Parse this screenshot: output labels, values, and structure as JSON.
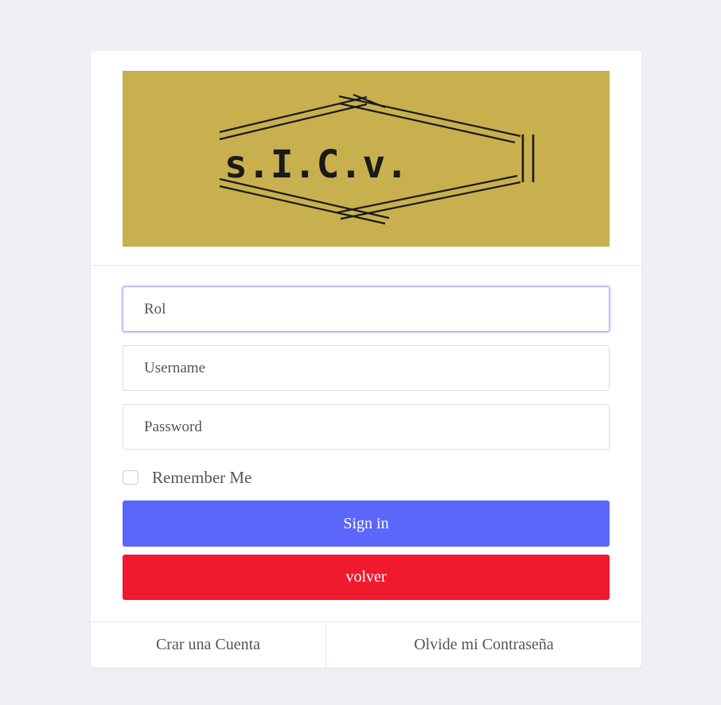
{
  "logo": {
    "text": "s.I.C.v.",
    "background_color": "#c9b04e"
  },
  "form": {
    "rol_placeholder": "Rol",
    "username_placeholder": "Username",
    "password_placeholder": "Password",
    "remember_label": "Remember Me",
    "signin_label": "Sign in",
    "back_label": "volver"
  },
  "footer": {
    "create_account_label": "Crar una Cuenta",
    "forgot_password_label": "Olvide mi Contraseña"
  },
  "colors": {
    "primary": "#5b67fb",
    "danger": "#ef1a2d",
    "page_background": "#eef0f5"
  }
}
